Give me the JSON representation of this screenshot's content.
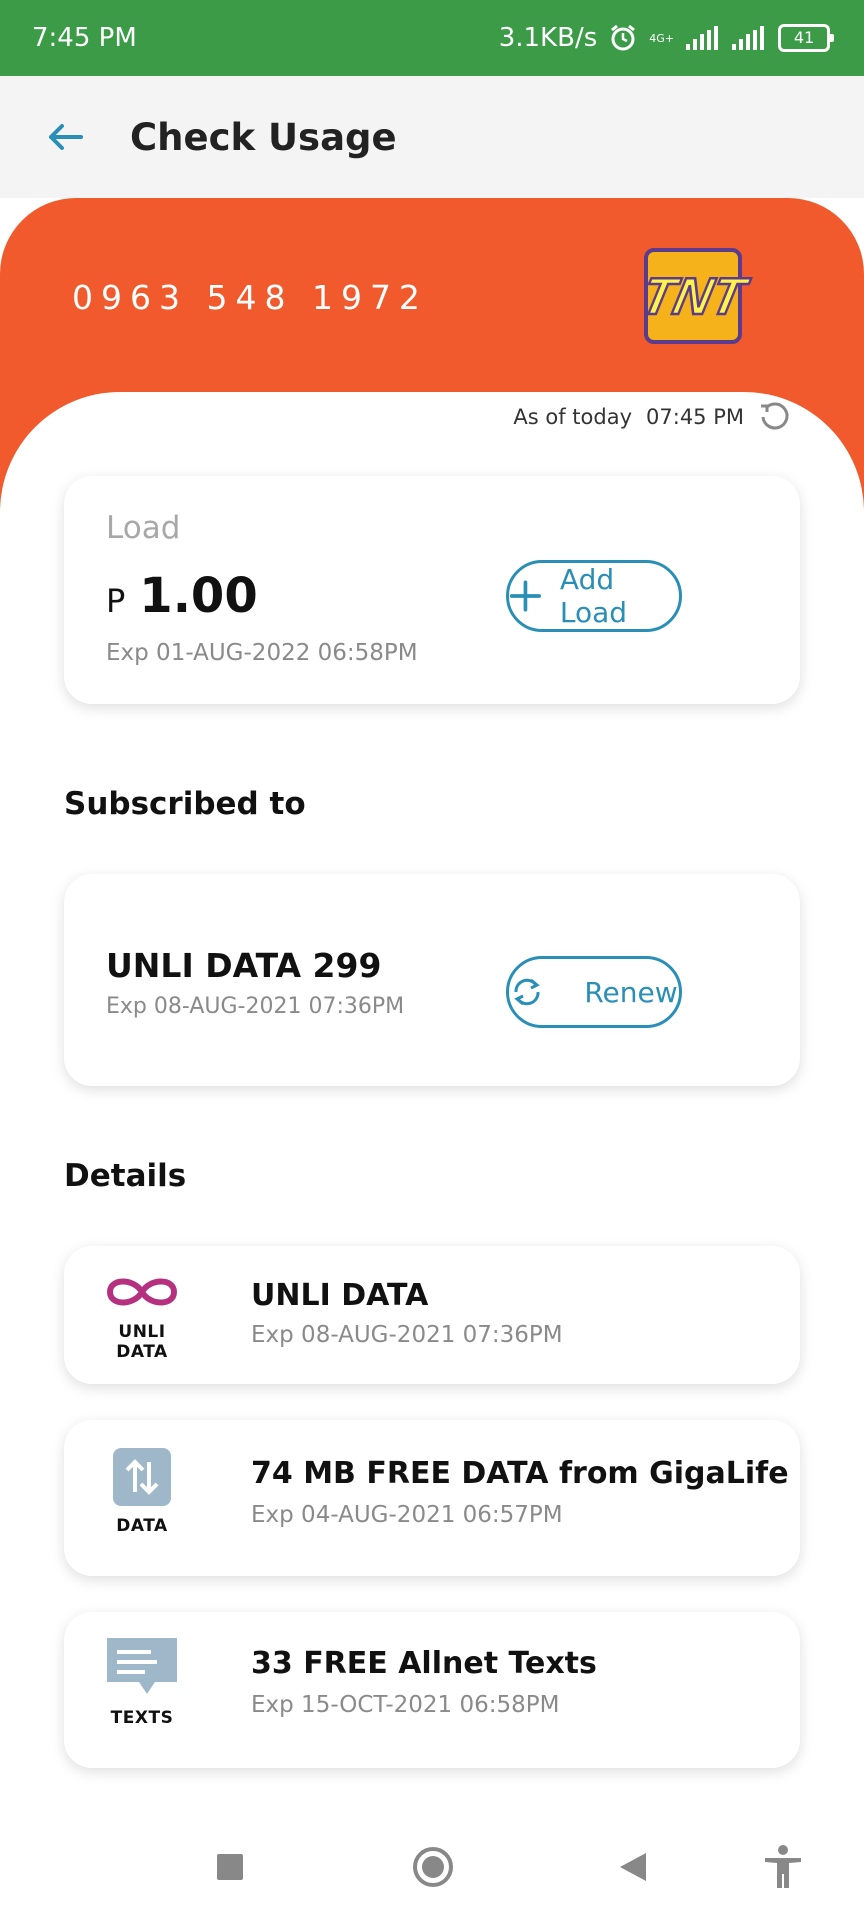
{
  "status_bar": {
    "time": "7:45 PM",
    "speed": "3.1KB/s",
    "network": "4G+",
    "battery": "41"
  },
  "app_bar": {
    "title": "Check Usage"
  },
  "account": {
    "number": "0963 548 1972",
    "brand": "TNT",
    "as_of_label": "As of today",
    "as_of_time": "07:45 PM"
  },
  "load": {
    "label": "Load",
    "currency": "P",
    "amount": "1.00",
    "expiry": "Exp 01-AUG-2022 06:58PM",
    "add_button": "Add Load"
  },
  "subscriptions": {
    "title": "Subscribed to",
    "plan": "UNLI DATA 299",
    "expiry": "Exp 08-AUG-2021 07:36PM",
    "renew_button": "Renew"
  },
  "details": {
    "title": "Details",
    "items": [
      {
        "icon": "infinity-icon",
        "caption": "UNLI DATA",
        "title": "UNLI DATA",
        "expiry": "Exp 08-AUG-2021 07:36PM",
        "color": "#b5317f"
      },
      {
        "icon": "data-transfer-icon",
        "caption": "DATA",
        "title": "74 MB FREE DATA from GigaLife",
        "expiry": "Exp 04-AUG-2021 06:57PM",
        "color": "#9fb8c9"
      },
      {
        "icon": "message-icon",
        "caption": "TEXTS",
        "title": "33 FREE Allnet Texts",
        "expiry": "Exp 15-OCT-2021 06:58PM",
        "color": "#9fb8c9"
      }
    ]
  },
  "colors": {
    "status_bar": "#3b9b47",
    "hero": "#f15a2c",
    "accent": "#2a8fb6"
  }
}
